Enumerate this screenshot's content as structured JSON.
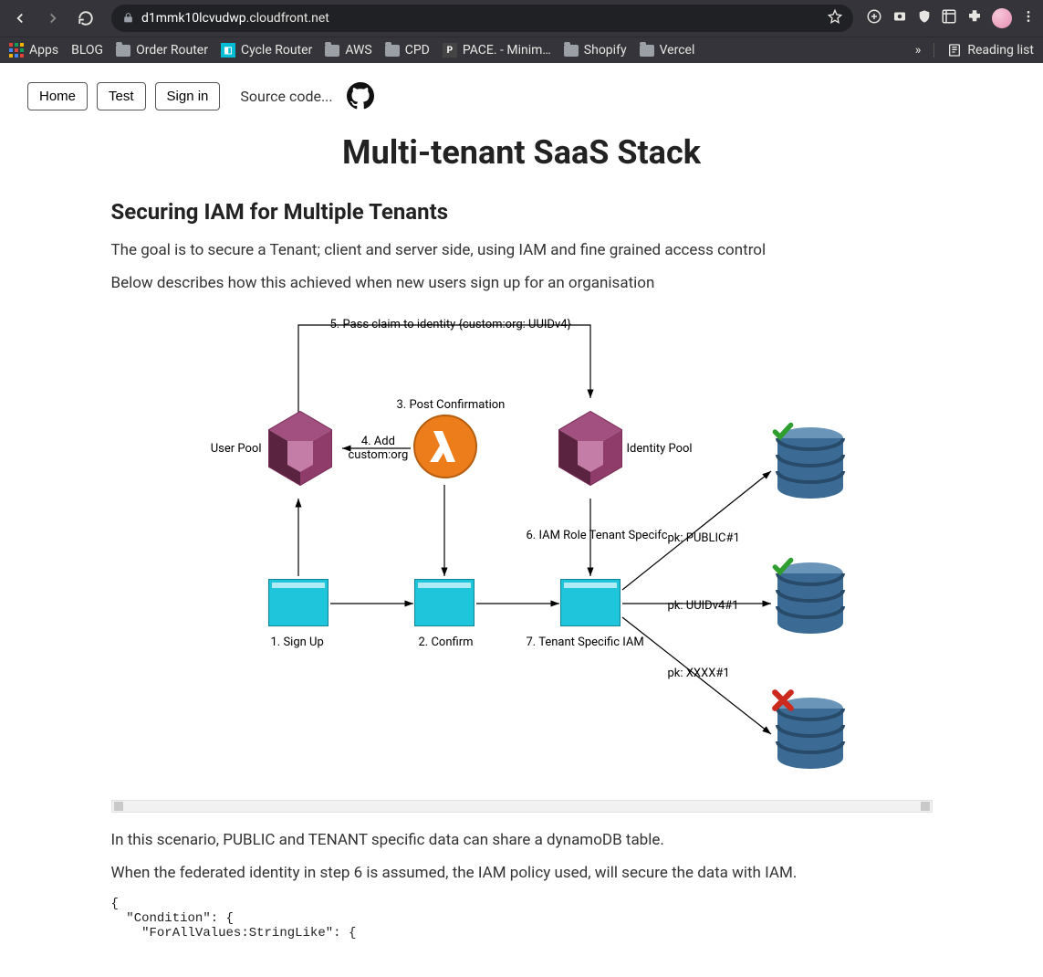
{
  "browser": {
    "url_prefix": "d1mmk10lcvudwp",
    "url_suffix": ".cloudfront.net",
    "bookmarks": [
      "Apps",
      "BLOG",
      "Order Router",
      "Cycle Router",
      "AWS",
      "CPD",
      "PACE. - Minim…",
      "Shopify",
      "Vercel"
    ],
    "reading_list": "Reading list"
  },
  "nav": {
    "home": "Home",
    "test": "Test",
    "signin": "Sign in",
    "source": "Source code..."
  },
  "page": {
    "title": "Multi-tenant SaaS Stack",
    "h2": "Securing IAM for Multiple Tenants",
    "p1": "The goal is to secure a Tenant; client and server side, using IAM and fine grained access control",
    "p2": "Below describes how this achieved when new users sign up for an organisation",
    "p3": "In this scenario, PUBLIC and TENANT specific data can share a dynamoDB table.",
    "p4": "When the federated identity in step 6 is assumed, the IAM policy used, will secure the data with IAM.",
    "code": "{\n  \"Condition\": {\n    \"ForAllValues:StringLike\": {"
  },
  "diagram": {
    "step5": "5. Pass claim to identity {custom:org: UUIDv4}",
    "user_pool": "User Pool",
    "identity_pool": "Identity Pool",
    "step3": "3. Post Confirmation",
    "step4": "4. Add\ncustom:org",
    "step6": "6. IAM Role Tenant Specifc",
    "signup": "1. Sign Up",
    "confirm": "2. Confirm",
    "step7": "7. Tenant Specific IAM",
    "pk_public": "pk: PUBLIC#1",
    "pk_uuid": "pk: UUIDv4#1",
    "pk_xxxx": "pk: XXXX#1"
  }
}
